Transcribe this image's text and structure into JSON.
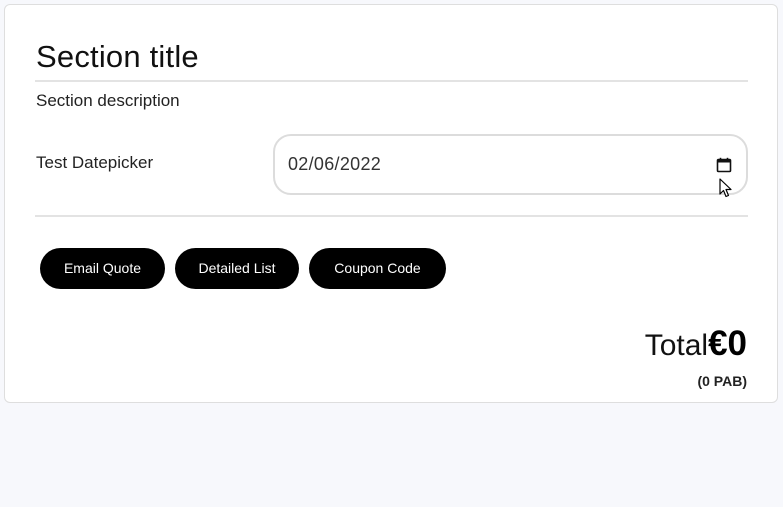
{
  "section": {
    "title": "Section title",
    "description": "Section description"
  },
  "datepicker": {
    "label": "Test Datepicker",
    "value": "02/06/2022",
    "icon": "calendar-icon"
  },
  "buttons": {
    "email_quote": "Email Quote",
    "detailed_list": "Detailed List",
    "coupon_code": "Coupon Code"
  },
  "total": {
    "label": "Total",
    "amount": "€0",
    "sub": "(0 PAB)"
  },
  "colors": {
    "button_bg": "#000000",
    "button_text": "#ffffff",
    "page_bg": "#f7f8fc"
  }
}
